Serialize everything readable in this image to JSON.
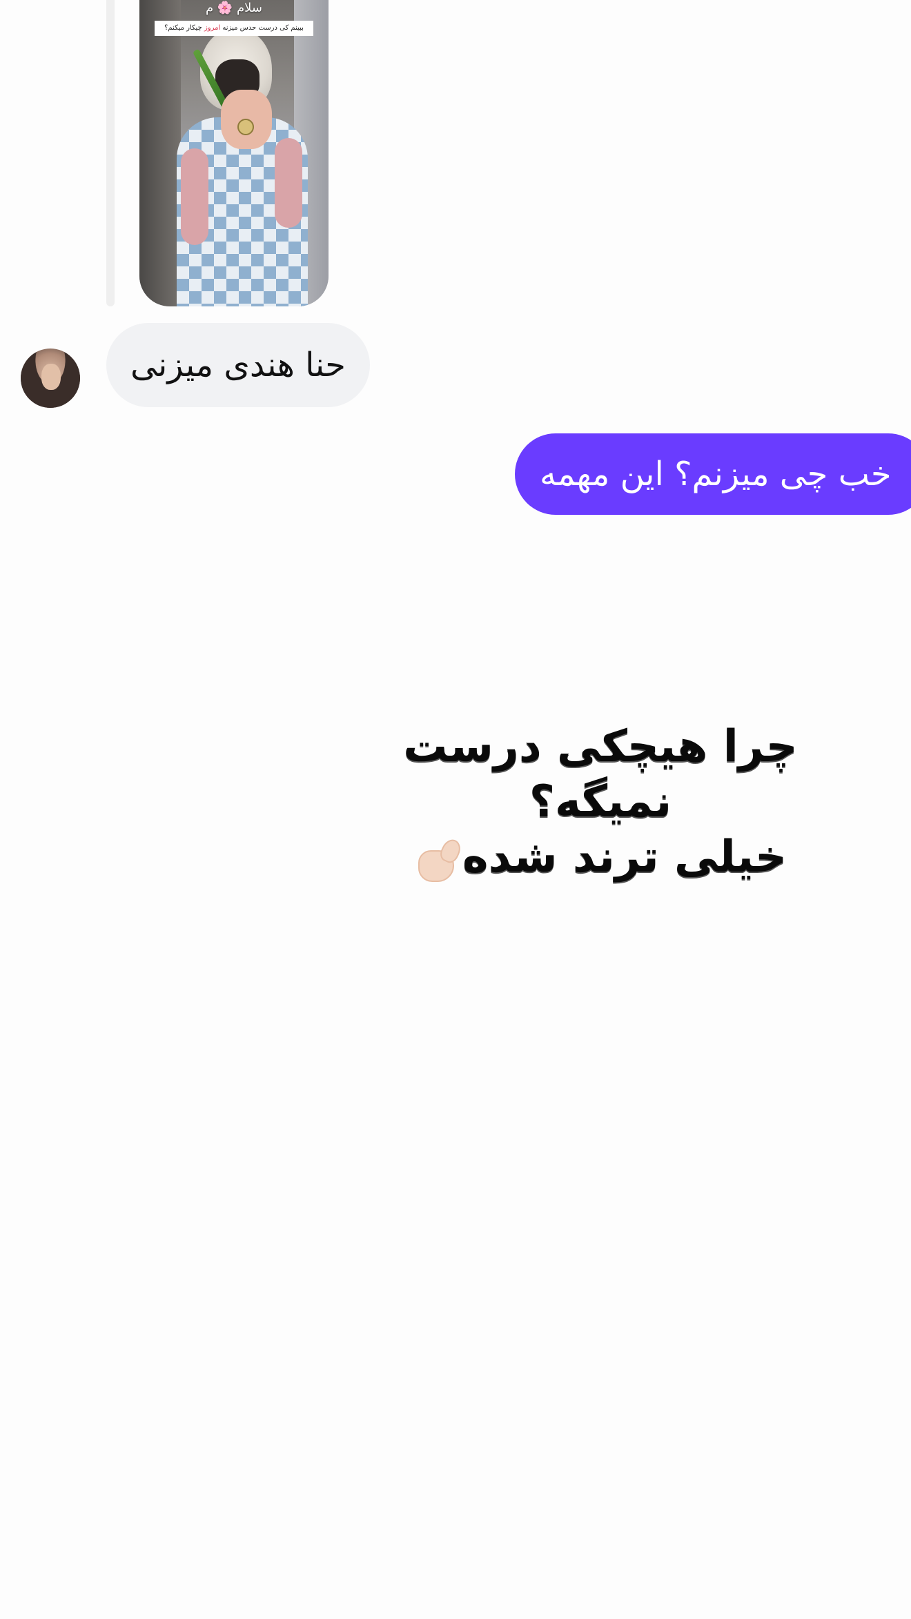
{
  "story_reply": {
    "title": "سلام 🌸 م",
    "caption_part1": "ببینم کی درست حدس میزنه ",
    "caption_highlight": "امروز",
    "caption_part2": " چیکار میکنم؟"
  },
  "messages": {
    "incoming_text": "حنا هندی میزنی",
    "outgoing_text": "خب چی میزنم؟ این مهمه"
  },
  "overlay": {
    "line1": "چرا هیچکی درست نمیگه؟",
    "line2": "خیلی ترند شده"
  },
  "icons": {
    "emoji": "pinching-hand-icon"
  },
  "colors": {
    "outgoing_bubble": "#6a3cff",
    "incoming_bubble": "#f1f2f4",
    "caption_highlight": "#d8324a"
  }
}
